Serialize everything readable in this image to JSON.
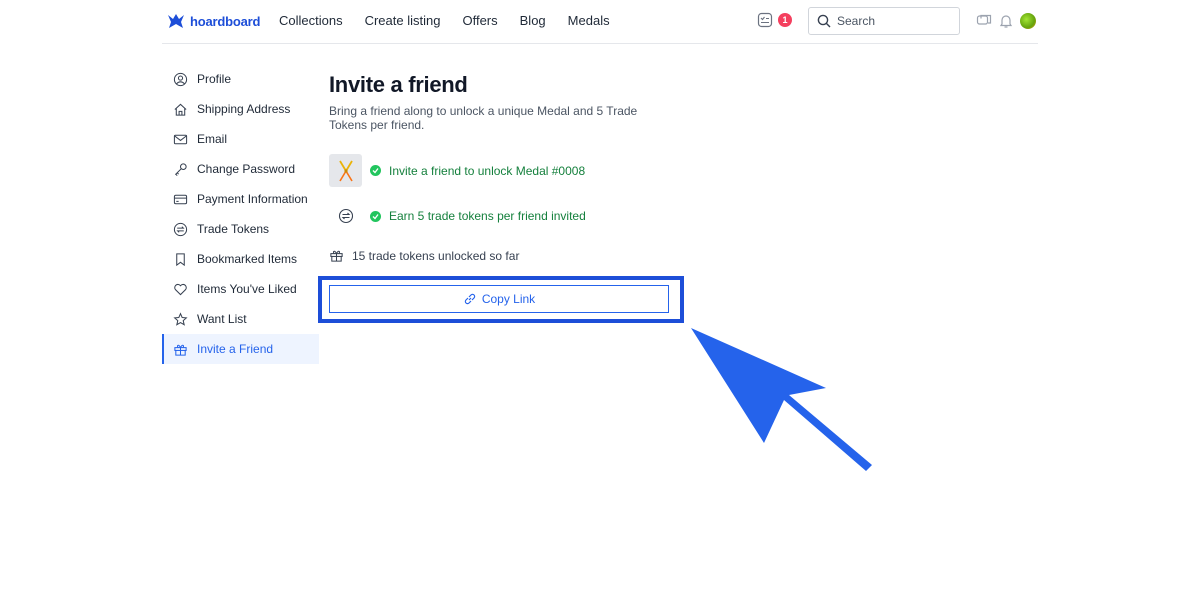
{
  "brand": {
    "name": "hoardboard",
    "color": "#1d4ed8"
  },
  "nav": {
    "items": [
      "Collections",
      "Create listing",
      "Offers",
      "Blog",
      "Medals"
    ]
  },
  "header": {
    "notification_count": "1",
    "search_placeholder": "Search",
    "icons": [
      "checklist-icon",
      "search-icon",
      "chat-icon",
      "bell-icon",
      "avatar"
    ]
  },
  "sidebar": {
    "items": [
      {
        "label": "Profile",
        "icon": "user-circle-icon"
      },
      {
        "label": "Shipping Address",
        "icon": "home-icon"
      },
      {
        "label": "Email",
        "icon": "mail-icon"
      },
      {
        "label": "Change Password",
        "icon": "key-icon"
      },
      {
        "label": "Payment Information",
        "icon": "credit-card-icon"
      },
      {
        "label": "Trade Tokens",
        "icon": "token-exchange-icon"
      },
      {
        "label": "Bookmarked Items",
        "icon": "bookmark-icon"
      },
      {
        "label": "Items You've Liked",
        "icon": "heart-icon"
      },
      {
        "label": "Want List",
        "icon": "star-icon"
      },
      {
        "label": "Invite a Friend",
        "icon": "gift-icon",
        "active": true
      }
    ]
  },
  "main": {
    "title": "Invite a friend",
    "subtitle": "Bring a friend along to unlock a unique Medal and 5 Trade Tokens per friend.",
    "benefits": [
      {
        "text": "Invite a friend to unlock Medal #0008",
        "icon": "medal-icon",
        "status": "check-icon"
      },
      {
        "text": "Earn 5 trade tokens per friend invited",
        "icon": "token-exchange-icon",
        "status": "check-icon"
      }
    ],
    "unlocked": {
      "text": "15 trade tokens unlocked so far",
      "icon": "gift-icon"
    },
    "copy_button": {
      "label": "Copy Link",
      "icon": "link-icon"
    }
  },
  "colors": {
    "accent": "#2563eb",
    "success": "#15803d",
    "badge": "#f43f5e",
    "highlight": "#1d4ed8"
  }
}
